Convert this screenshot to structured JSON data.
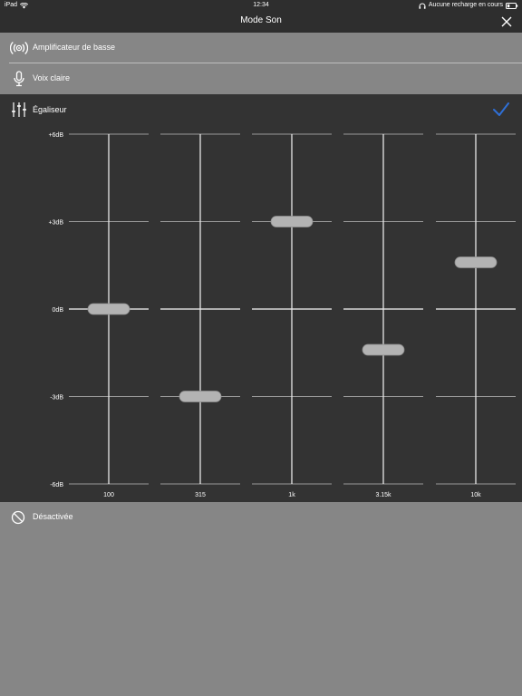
{
  "status_bar": {
    "device": "iPad",
    "time": "12:34",
    "charging": "Aucune recharge en cours"
  },
  "header": {
    "title": "Mode Son",
    "close_icon": "close-icon"
  },
  "modes": [
    {
      "label": "Amplificateur de basse",
      "icon": "speaker-waves-icon"
    },
    {
      "label": "Voix claire",
      "icon": "microphone-icon"
    }
  ],
  "equalizer": {
    "label": "Égaliseur",
    "icon": "equalizer-sliders-icon",
    "selected": true,
    "check_icon": "checkmark-icon"
  },
  "off_mode": {
    "label": "Désactivée",
    "icon": "prohibited-icon"
  },
  "colors": {
    "accent": "#2f6fd6",
    "panel": "#333333",
    "background": "#868686",
    "bar": "#2e2e2e"
  },
  "chart_data": {
    "type": "equalizer",
    "y_ticks": [
      "+6dB",
      "+3dB",
      "0dB",
      "-3dB",
      "-6dB"
    ],
    "ylim": [
      -6,
      6
    ],
    "categories": [
      "100",
      "315",
      "1k",
      "3.15k",
      "10k"
    ],
    "values": [
      0,
      -3,
      3,
      -1.4,
      1.6
    ]
  }
}
